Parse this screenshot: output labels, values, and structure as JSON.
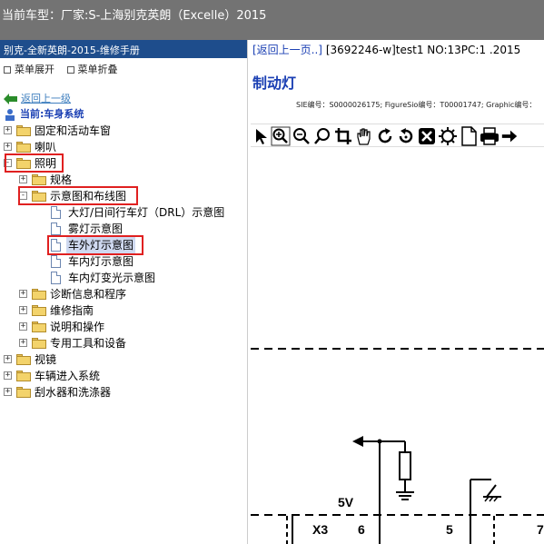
{
  "titlebar": {
    "text": "当前车型：厂家:S-上海别克英朗（Excelle）2015"
  },
  "left": {
    "header": "别克-全新英朗-2015-维修手册",
    "expand_label": "菜单展开",
    "collapse_label": "菜单折叠",
    "back_label": "返回上一级",
    "current_label": "当前:车身系统",
    "tree": [
      {
        "label": "固定和活动车窗"
      },
      {
        "label": "喇叭"
      },
      {
        "label": "照明"
      },
      {
        "label": "规格"
      },
      {
        "label": "示意图和布线图"
      },
      {
        "label": "大灯/日间行车灯（DRL）示意图"
      },
      {
        "label": "雾灯示意图"
      },
      {
        "label": "车外灯示意图"
      },
      {
        "label": "车内灯示意图"
      },
      {
        "label": "车内灯变光示意图"
      },
      {
        "label": "诊断信息和程序"
      },
      {
        "label": "维修指南"
      },
      {
        "label": "说明和操作"
      },
      {
        "label": "专用工具和设备"
      },
      {
        "label": "视镜"
      },
      {
        "label": "车辆进入系统"
      },
      {
        "label": "刮水器和洗涤器"
      }
    ]
  },
  "right": {
    "top_link": "[返回上一页..]",
    "top_text": "[3692246-w]test1 NO:13PC:1 .2015",
    "title": "制动灯",
    "ids": "SIE编号：S0000026175;  FigureSio编号：T00001747;  Graphic编号：",
    "diagram": {
      "label_5v": "5V",
      "label_x3": "X3",
      "label_6": "6",
      "label_5": "5",
      "label_7": "7"
    }
  },
  "colors": {
    "titlebar": "#737373",
    "header": "#1e4d8c",
    "link": "#1a3fb3",
    "highlight": "#e02020"
  },
  "icons": [
    "pointer-icon",
    "zoom-box-icon",
    "zoom-out-icon",
    "search-icon",
    "crop-icon",
    "pan-hand-icon",
    "rotate-right-icon",
    "rotate-left-icon",
    "fit-icon",
    "settings-icon",
    "page-icon",
    "print-icon",
    "next-icon"
  ]
}
